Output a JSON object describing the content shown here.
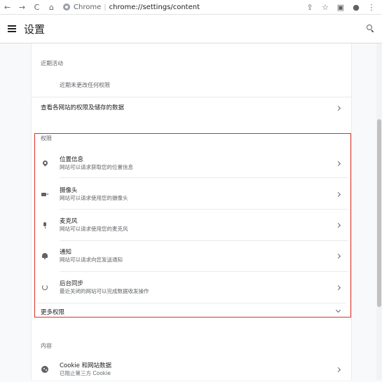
{
  "browser": {
    "back_icon": "←",
    "forward_icon": "→",
    "reload_icon": "C",
    "home_icon": "⌂",
    "app_name": "Chrome",
    "separator": "|",
    "url": "chrome://settings/content",
    "share_icon": "⇪",
    "star_icon": "☆",
    "sidepanel_icon": "▣",
    "profile_icon": "●",
    "menu_icon": "⋮"
  },
  "header": {
    "title": "设置"
  },
  "recent_activity": {
    "title": "近期活动",
    "empty_text": "近期未更改任何权限",
    "view_all_label": "查看各网站的权限及储存的数据"
  },
  "permissions": {
    "title": "权限",
    "items": [
      {
        "label": "位置信息",
        "desc": "网站可以请求获取您的位置信息",
        "icon": "location-icon"
      },
      {
        "label": "摄像头",
        "desc": "网站可以请求使用您的摄像头",
        "icon": "camera-icon"
      },
      {
        "label": "麦克风",
        "desc": "网站可以请求使用您的麦克风",
        "icon": "microphone-icon"
      },
      {
        "label": "通知",
        "desc": "网站可以请求向您发送通知",
        "icon": "bell-icon"
      },
      {
        "label": "后台同步",
        "desc": "最近关闭的网站可以完成数据收发操作",
        "icon": "sync-icon"
      }
    ],
    "more_label": "更多权限"
  },
  "content": {
    "title": "内容",
    "items": [
      {
        "label": "Cookie 和网站数据",
        "desc": "已阻止第三方 Cookie",
        "icon": "cookie-icon"
      }
    ]
  },
  "colors": {
    "highlight": "#d93025",
    "accent": "#1a73e8"
  }
}
